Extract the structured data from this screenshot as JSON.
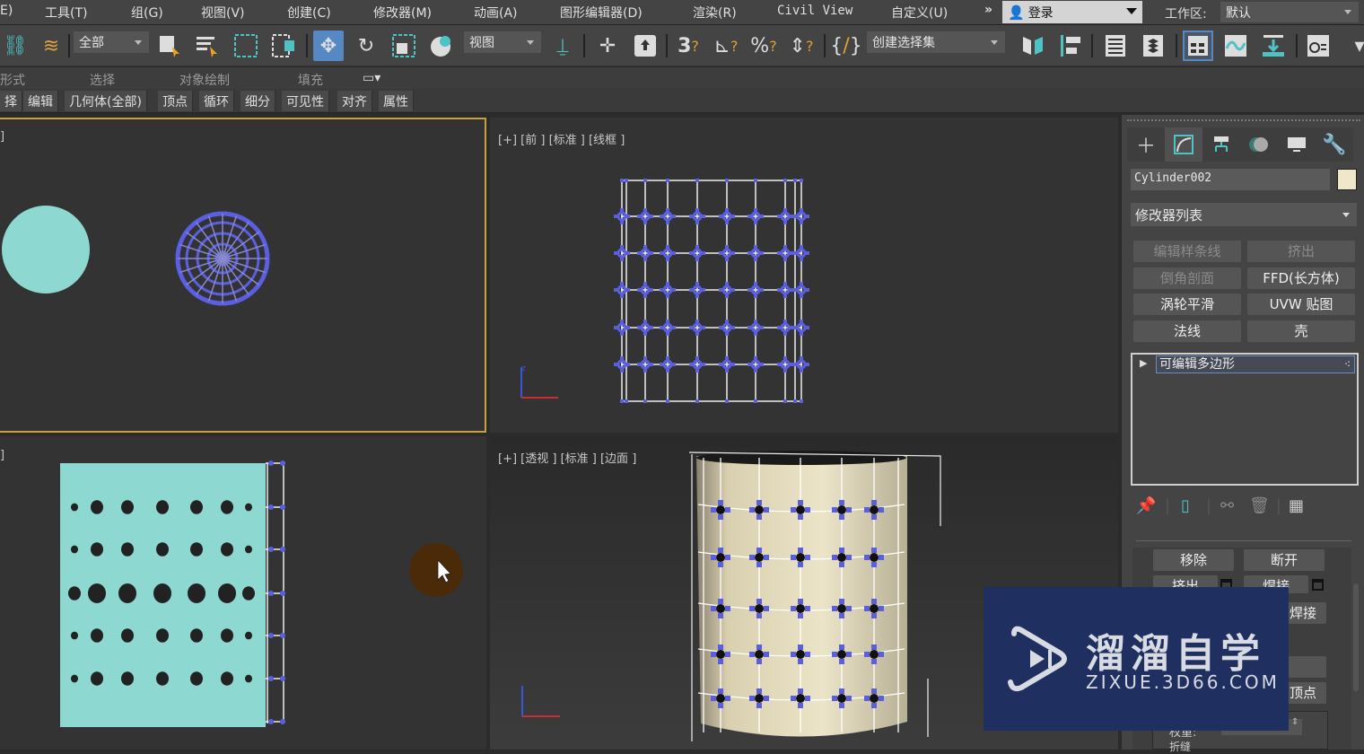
{
  "menubar": {
    "items": [
      "E)",
      "工具(T)",
      "组(G)",
      "视图(V)",
      "创建(C)",
      "修改器(M)",
      "动画(A)",
      "图形编辑器(D)",
      "渲染(R)",
      "Civil View",
      "自定义(U)"
    ],
    "overflow": "»",
    "login_label": "登录",
    "workspace_label": "工作区:",
    "workspace_value": "默认"
  },
  "toolbar": {
    "selection_filter": "全部",
    "reference_coord": "视图",
    "named_selection_placeholder": "创建选择集",
    "active_tool": "select-and-move"
  },
  "ribbon": {
    "groups": [
      "形式",
      "选择",
      "对象绘制",
      "填充"
    ],
    "tabs": [
      "择",
      "编辑",
      "几何体(全部)",
      "顶点",
      "循环",
      "细分",
      "可见性",
      "对齐",
      "属性"
    ]
  },
  "viewports": {
    "top_left": {
      "label": "]"
    },
    "top_right": {
      "label": "[+] [前 ] [标准 ] [线框 ]"
    },
    "bottom_left": {
      "label": "]"
    },
    "bottom_right": {
      "label": "[+] [透视 ] [标准 ] [边面 ]"
    }
  },
  "command_panel": {
    "tabs": [
      "create",
      "modify",
      "hierarchy",
      "motion",
      "display",
      "utilities"
    ],
    "object_name": "Cylinder002",
    "object_color": "#f0e6c8",
    "modifier_list": "修改器列表",
    "modifier_buttons": [
      {
        "label": "编辑样条线",
        "enabled": false
      },
      {
        "label": "挤出",
        "enabled": false
      },
      {
        "label": "倒角剖面",
        "enabled": false
      },
      {
        "label": "FFD(长方体)",
        "enabled": true
      },
      {
        "label": "涡轮平滑",
        "enabled": true
      },
      {
        "label": "UVW 贴图",
        "enabled": true
      },
      {
        "label": "法线",
        "enabled": true
      },
      {
        "label": "壳",
        "enabled": true
      }
    ],
    "stack_items": [
      "可编辑多边形"
    ],
    "rollout_buttons": [
      "移除",
      "断开",
      "挤出",
      "焊接",
      "焊接",
      "顶点"
    ],
    "partial_labels": [
      "权重:",
      "折缝"
    ]
  },
  "watermark": {
    "title": "溜溜自学",
    "url": "ZIXUE.3D66.COM"
  },
  "colors": {
    "accent_blue": "#5688c4",
    "selection_vertex": "#5a5ee0",
    "cyan_mesh": "#8ed8d2",
    "active_viewport_border": "#c8a040"
  }
}
